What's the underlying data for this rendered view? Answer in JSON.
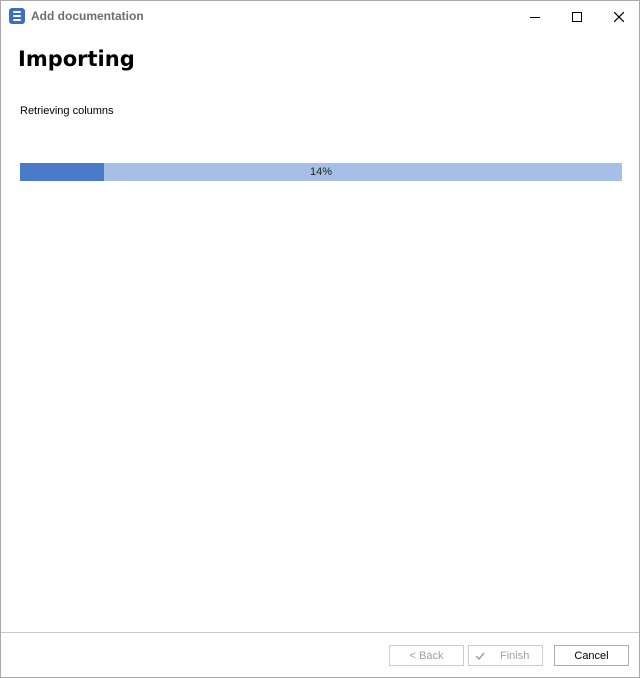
{
  "window": {
    "title": "Add documentation",
    "controls": [
      "minimize-icon",
      "maximize-icon",
      "close-icon"
    ]
  },
  "main": {
    "heading": "Importing",
    "status": "Retrieving columns",
    "progress": {
      "value_percent": 14,
      "label": "14%",
      "colors": {
        "fill": "#4a7bcb",
        "track": "#a6bfe6"
      }
    }
  },
  "footer": {
    "back_label": "< Back",
    "finish_label": "Finish",
    "cancel_label": "Cancel"
  }
}
